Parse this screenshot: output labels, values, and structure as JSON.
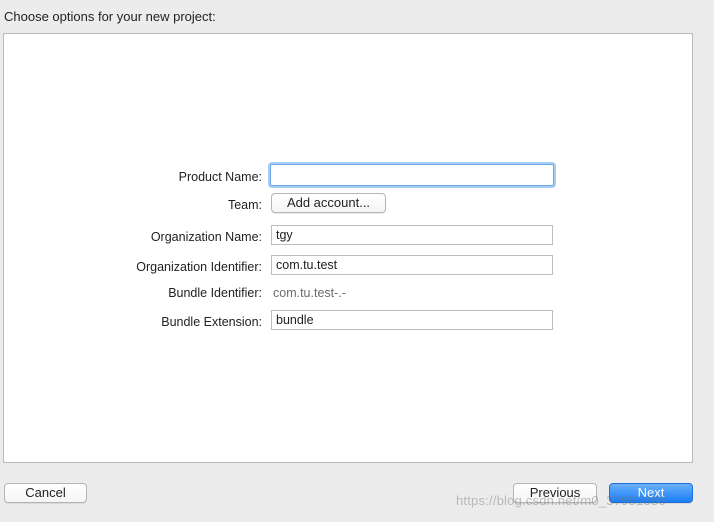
{
  "dialog": {
    "title": "Choose options for your new project:"
  },
  "form": {
    "product_name": {
      "label": "Product Name:",
      "value": ""
    },
    "team": {
      "label": "Team:",
      "button_label": "Add account..."
    },
    "organization_name": {
      "label": "Organization Name:",
      "value": "tgy"
    },
    "organization_identifier": {
      "label": "Organization Identifier:",
      "value": "com.tu.test"
    },
    "bundle_identifier": {
      "label": "Bundle Identifier:",
      "value": "com.tu.test-.-"
    },
    "bundle_extension": {
      "label": "Bundle Extension:",
      "value": "bundle"
    }
  },
  "footer": {
    "cancel_label": "Cancel",
    "previous_label": "Previous",
    "next_label": "Next"
  },
  "watermark": {
    "text": "https://blog.csdn.net/m0_37981386"
  },
  "colors": {
    "accent": "#1a7ef5",
    "focus_ring": "#a8cdf4",
    "window_background": "#ececec"
  }
}
